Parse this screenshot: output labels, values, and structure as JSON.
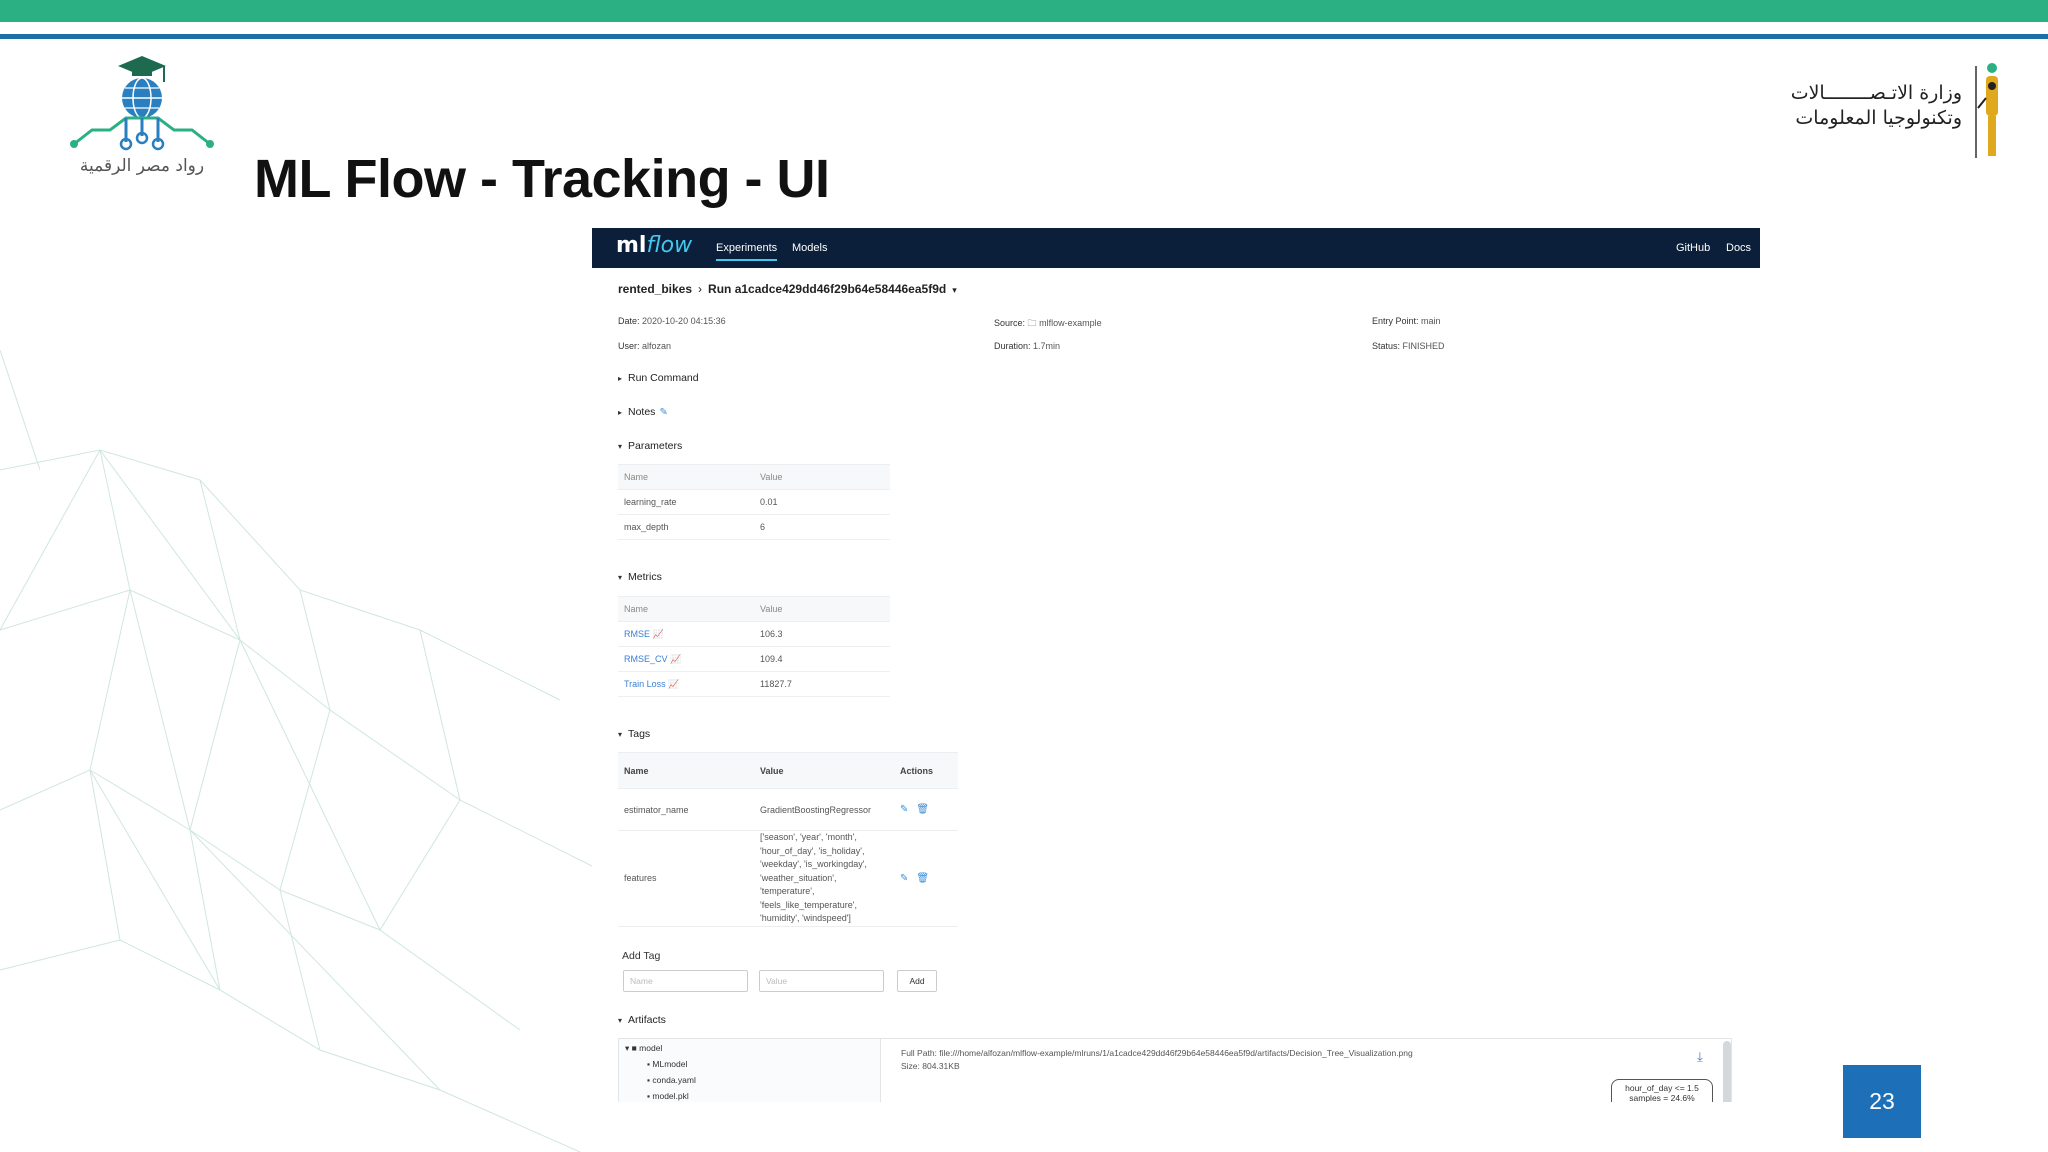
{
  "slide": {
    "title": "ML Flow - Tracking - UI",
    "page_number": "23",
    "logo_left_text": "رواد مصر الرقمية",
    "logo_right_line1": "وزارة الاتـصــــــــالات",
    "logo_right_line2": "وتكنولوجيا المعلومات"
  },
  "mlflow": {
    "brand_ml": "ml",
    "brand_flow": "flow",
    "nav": {
      "experiments": "Experiments",
      "models": "Models",
      "github": "GitHub",
      "docs": "Docs"
    },
    "breadcrumb": {
      "experiment": "rented_bikes",
      "separator": "›",
      "run": "Run a1cadce429dd46f29b64e58446ea5f9d",
      "caret": "▾"
    },
    "meta": {
      "date_label": "Date:",
      "date": "2020-10-20 04:15:36",
      "user_label": "User:",
      "user": "alfozan",
      "source_label": "Source:",
      "source": "mlflow-example",
      "duration_label": "Duration:",
      "duration": "1.7min",
      "entry_label": "Entry Point:",
      "entry": "main",
      "status_label": "Status:",
      "status": "FINISHED"
    },
    "sections": {
      "run_command": "Run Command",
      "notes": "Notes",
      "parameters": "Parameters",
      "metrics": "Metrics",
      "tags": "Tags",
      "artifacts": "Artifacts"
    },
    "params_header": {
      "name": "Name",
      "value": "Value"
    },
    "params": [
      {
        "name": "learning_rate",
        "value": "0.01"
      },
      {
        "name": "max_depth",
        "value": "6"
      }
    ],
    "metrics_header": {
      "name": "Name",
      "value": "Value"
    },
    "metrics": [
      {
        "name": "RMSE",
        "value": "106.3"
      },
      {
        "name": "RMSE_CV",
        "value": "109.4"
      },
      {
        "name": "Train Loss",
        "value": "11827.7"
      }
    ],
    "tags_header": {
      "name": "Name",
      "value": "Value",
      "actions": "Actions"
    },
    "tags": [
      {
        "name": "estimator_name",
        "value": "GradientBoostingRegressor"
      },
      {
        "name": "features",
        "value_lines": [
          "['season', 'year', 'month',",
          "'hour_of_day', 'is_holiday',",
          "'weekday', 'is_workingday',",
          "'weather_situation',",
          "'temperature',",
          "'feels_like_temperature',",
          "'humidity', 'windspeed']"
        ]
      }
    ],
    "add_tag": {
      "label": "Add Tag",
      "name_placeholder": "Name",
      "value_placeholder": "Value",
      "button": "Add"
    },
    "artifacts": {
      "tree": [
        "model",
        "MLmodel",
        "conda.yaml",
        "model.pkl"
      ],
      "full_path_label": "Full Path:",
      "full_path": "file:///home/alfozan/mlflow-example/mlruns/1/a1cadce429dd46f29b64e58446ea5f9d/artifacts/Decision_Tree_Visualization.png",
      "size_label": "Size:",
      "size": "804.31KB",
      "node_line1": "hour_of_day <= 1.5",
      "node_line2": "samples = 24.6%"
    }
  },
  "colors": {
    "nav_bg": "#0b1f3a",
    "accent": "#43c9ed",
    "link": "#3b7fd4",
    "green_bar": "#2bb083",
    "blue_bar": "#1d6fa8"
  }
}
